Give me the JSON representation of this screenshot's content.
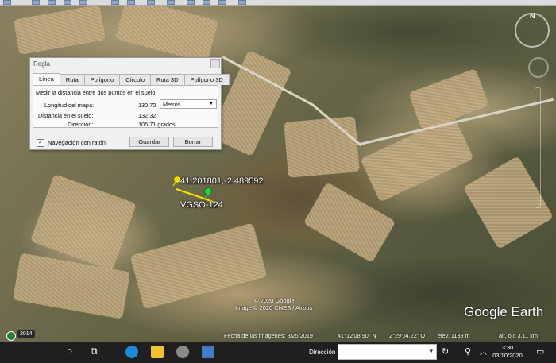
{
  "dialog": {
    "title": "Regla",
    "tabs": [
      {
        "label": "Línea",
        "active": true
      },
      {
        "label": "Ruta"
      },
      {
        "label": "Polígono"
      },
      {
        "label": "Círculo"
      },
      {
        "label": "Ruta 3D"
      },
      {
        "label": "Polígono 3D"
      }
    ],
    "description": "Medir la distancia entre dos puntos en el suelo",
    "map_length_label": "Longitud del mapa:",
    "map_length_value": "130,70",
    "unit_selected": "Metros",
    "ground_distance_label": "Distancia en el suelo:",
    "ground_distance_value": "132,32",
    "direction_label": "Dirección:",
    "direction_value": "105,71 grados",
    "mouse_nav_label": "Navegación con ratón",
    "mouse_nav_checked": true,
    "save_label": "Guardar",
    "clear_label": "Borrar"
  },
  "map": {
    "coordinate_label": "41.201801,-2.489592",
    "placemark_label": "VGSO-124",
    "copyright_1": "© 2020 Google",
    "copyright_2": "Image © 2020 CNES / Airbus",
    "logo": "Google Earth",
    "compass_letter": "N",
    "year_badge": "2014",
    "measure_line_color": "#ffe400"
  },
  "status_bar": {
    "imagery_date": "Fecha de las imágenes: 8/25/2019",
    "lat": "41°12'08.90\" N",
    "lon": "2°29'04.22\" O",
    "elev": "elev. 1139 m",
    "eye_alt": "alt. ojo 3.11 km"
  },
  "taskbar": {
    "search_label": "Dirección",
    "time": "3:30",
    "date": "03/10/2020"
  }
}
